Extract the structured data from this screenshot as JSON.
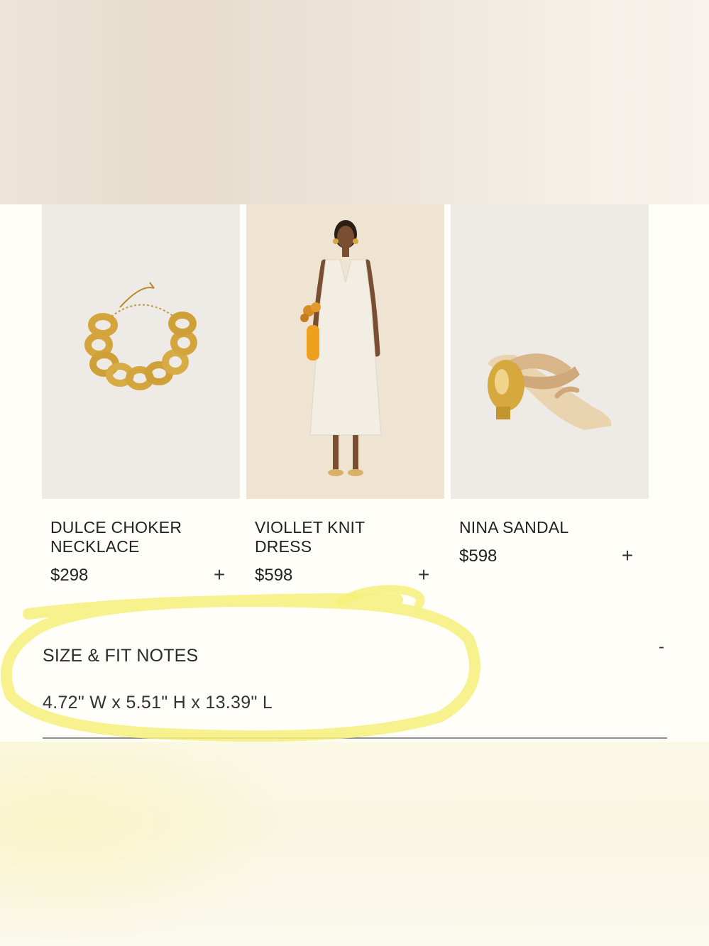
{
  "products": [
    {
      "name": "DULCE CHOKER NECKLACE",
      "price": "$298",
      "add_label": "+",
      "image_icon": "gold-chain-necklace"
    },
    {
      "name": "VIOLLET KNIT DRESS",
      "price": "$598",
      "add_label": "+",
      "image_icon": "white-knit-dress-model"
    },
    {
      "name": "NINA SANDAL",
      "price": "$598",
      "add_label": "+",
      "image_icon": "tan-sandal"
    }
  ],
  "size_fit": {
    "title": "SIZE & FIT NOTES",
    "toggle_label": "-",
    "dimensions": "4.72\" W x 5.51\" H x 13.39\" L"
  },
  "colors": {
    "background": "#fffef8",
    "image_bg": "#eeebe6",
    "highlight": "#f6f07a",
    "gold": "#d6a93f"
  }
}
